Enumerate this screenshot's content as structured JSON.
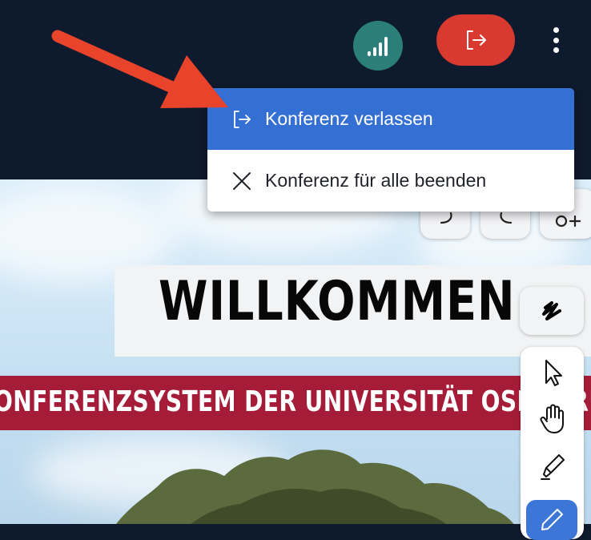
{
  "topbar": {
    "connection_icon": "signal-bars-icon",
    "leave_icon": "leave-arrow-icon",
    "more_icon": "vertical-dots-icon"
  },
  "menu": {
    "items": [
      {
        "label": "Konferenz verlassen",
        "icon": "leave-arrow-icon",
        "highlighted": true
      },
      {
        "label": "Konferenz für alle beenden",
        "icon": "close-icon",
        "highlighted": false
      }
    ]
  },
  "slide": {
    "title": "WILLKOMMEN",
    "banner": "ONFERENZSYSTEM DER UNIVERSITÄT OSNABRÜ"
  },
  "toolbar": {
    "tools": [
      "select-pointer-icon",
      "hand-pan-icon",
      "highlighter-icon",
      "pencil-icon"
    ],
    "active_tool": "pencil-icon",
    "accent": "#3c76d6"
  },
  "colors": {
    "leave_button": "#d93a2f",
    "connection_button": "#2b7e79",
    "menu_highlight": "#3470d4",
    "banner": "#a51c38",
    "arrow": "#e8442b"
  }
}
